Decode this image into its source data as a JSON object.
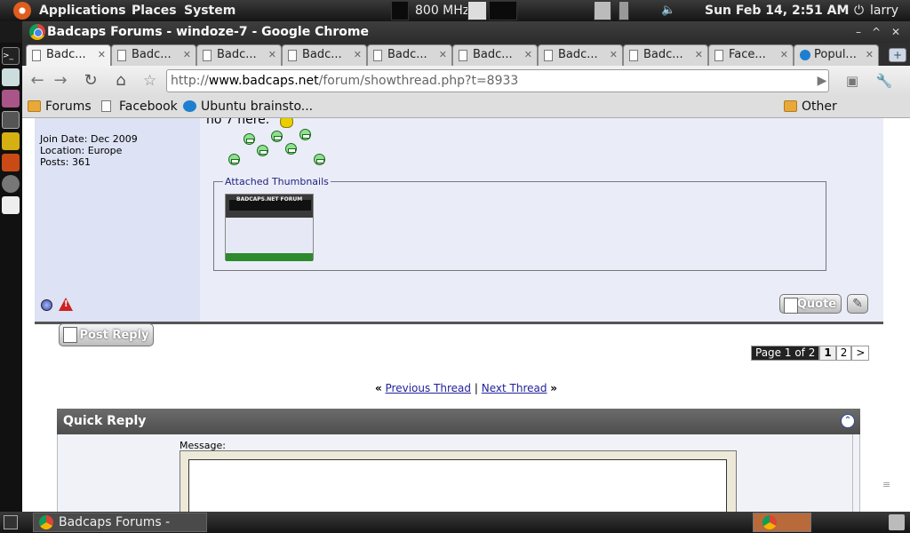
{
  "panel": {
    "applications": "Applications",
    "places": "Places",
    "system": "System",
    "cpu_freq": "800 MHz",
    "datetime": "Sun Feb 14,  2:51 AM",
    "user": "larry"
  },
  "window": {
    "title": "Badcaps Forums - windoze-7 - Google Chrome"
  },
  "tabs": [
    {
      "label": "Badc...",
      "active": true
    },
    {
      "label": "Badc..."
    },
    {
      "label": "Badc..."
    },
    {
      "label": "Badc..."
    },
    {
      "label": "Badc..."
    },
    {
      "label": "Badc..."
    },
    {
      "label": "Badc..."
    },
    {
      "label": "Badc..."
    },
    {
      "label": "Face..."
    },
    {
      "label": "Popul..."
    }
  ],
  "address": {
    "scheme": "http://",
    "domain": "www.badcaps.net",
    "path": "/forum/showthread.php?t=8933"
  },
  "bookmarks": {
    "items": [
      "Forums",
      "Facebook",
      "Ubuntu brainsto..."
    ],
    "other": "Other Bookmarks"
  },
  "post": {
    "join_date": "Join Date: Dec 2009",
    "location": "Location: Europe",
    "posts": "Posts: 361",
    "text_fragment": "no  7 here.",
    "attachments_legend": "Attached Thumbnails",
    "thumbnail_caption": "BADCAPS.NET FORUM",
    "quote_label": "Quote"
  },
  "actions": {
    "post_reply": "Post Reply"
  },
  "pagination": {
    "label": "Page 1 of 2",
    "current": "1",
    "next_page": "2",
    "next_arrow": ">"
  },
  "thread_nav": {
    "prev_quote": "«",
    "previous": "Previous Thread",
    "separator": "|",
    "next": "Next Thread",
    "next_quote": "»"
  },
  "quick_reply": {
    "title": "Quick Reply",
    "message_label": "Message:"
  },
  "taskbar": {
    "task": "Badcaps Forums - win..."
  }
}
